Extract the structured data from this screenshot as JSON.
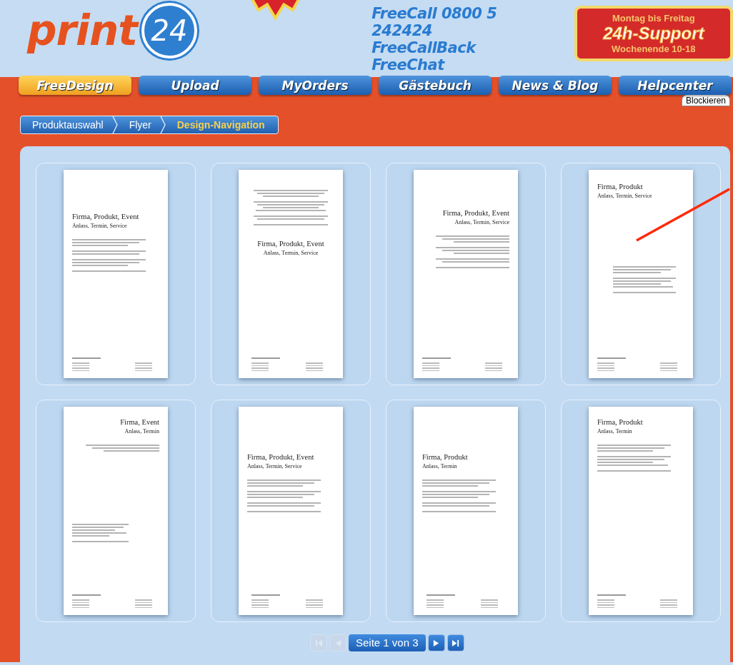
{
  "logo": {
    "word": "print",
    "number": "24"
  },
  "contact": [
    "FreeCall 0800 5 242424",
    "FreeCallBack",
    "FreeChat"
  ],
  "support": {
    "top": "Montag bis Freitag",
    "main": "24h-Support",
    "bottom": "Wochenende 10-18"
  },
  "nav": [
    {
      "label": "FreeDesign",
      "selected": true
    },
    {
      "label": "Upload",
      "selected": false
    },
    {
      "label": "MyOrders",
      "selected": false
    },
    {
      "label": "Gästebuch",
      "selected": false
    },
    {
      "label": "News & Blog",
      "selected": false
    },
    {
      "label": "Helpcenter",
      "selected": false
    }
  ],
  "block_tab": "Blockieren",
  "breadcrumb": [
    {
      "label": "Produktauswahl",
      "selected": false
    },
    {
      "label": "Flyer",
      "selected": false
    },
    {
      "label": "Design-Navigation",
      "selected": true
    }
  ],
  "flyers": [
    {
      "kind": "classic",
      "title": "Firma, Produkt, Event",
      "subtitle": "Anlass, Termin, Service"
    },
    {
      "kind": "centered",
      "title": "Firma, Produkt, Event",
      "subtitle": "Anlass, Termin, Service"
    },
    {
      "kind": "right",
      "title": "Firma, Produkt, Event",
      "subtitle": "Anlass, Termin, Service"
    },
    {
      "kind": "topleft",
      "title": "Firma, Produkt",
      "subtitle": "Anlass, Termin, Service"
    },
    {
      "kind": "split",
      "title": "Firma, Event",
      "subtitle": "Anlass, Termin"
    },
    {
      "kind": "upper",
      "title": "Firma, Produkt, Event",
      "subtitle": "Anlass, Termin, Service"
    },
    {
      "kind": "upper",
      "title": "Firma, Produkt",
      "subtitle": "Anlass, Termin"
    },
    {
      "kind": "top",
      "title": "Firma, Produkt",
      "subtitle": "Anlass, Termin"
    }
  ],
  "pager": {
    "label": "Seite 1 von 3",
    "first_disabled": true,
    "prev_disabled": true,
    "next_disabled": false,
    "last_disabled": false
  }
}
